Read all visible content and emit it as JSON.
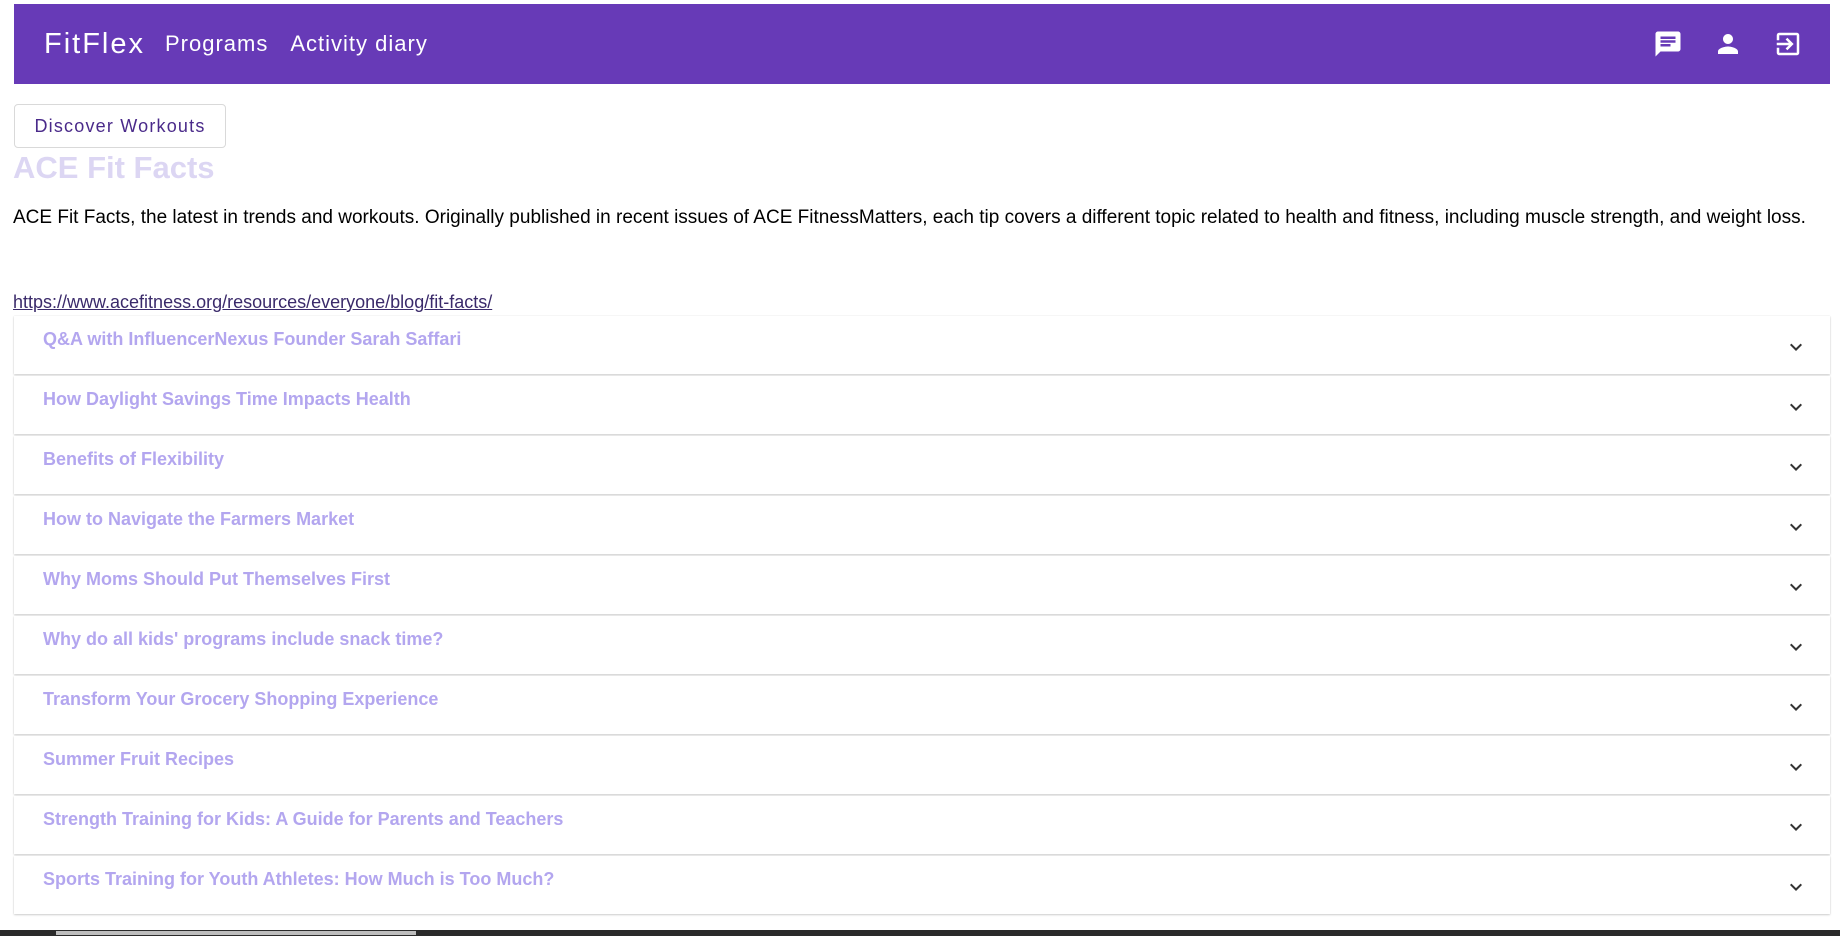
{
  "appbar": {
    "brand": "FitFlex",
    "nav": [
      "Programs",
      "Activity diary"
    ],
    "icons": [
      "chat-icon",
      "account-icon",
      "logout-icon"
    ],
    "color": "#673ab7"
  },
  "actions": {
    "discover_label": "Discover Workouts"
  },
  "article": {
    "title": "ACE Fit Facts",
    "description": "ACE Fit Facts, the latest in trends and workouts. Originally published in recent issues of ACE FitnessMatters, each tip covers a different topic related to health and fitness, including muscle strength, and weight loss.",
    "link": "https://www.acefitness.org/resources/everyone/blog/fit-facts/"
  },
  "items": [
    {
      "title": "Q&A with InfluencerNexus Founder Sarah Saffari"
    },
    {
      "title": "How Daylight Savings Time Impacts Health"
    },
    {
      "title": "Benefits of Flexibility"
    },
    {
      "title": "How to Navigate the Farmers Market"
    },
    {
      "title": "Why Moms Should Put Themselves First"
    },
    {
      "title": "Why do all kids' programs include snack time?"
    },
    {
      "title": "Transform Your Grocery Shopping Experience"
    },
    {
      "title": "Summer Fruit Recipes"
    },
    {
      "title": "Strength Training for Kids: A Guide for Parents and Teachers"
    },
    {
      "title": "Sports Training for Youth Athletes: How Much is Too Much?"
    }
  ]
}
